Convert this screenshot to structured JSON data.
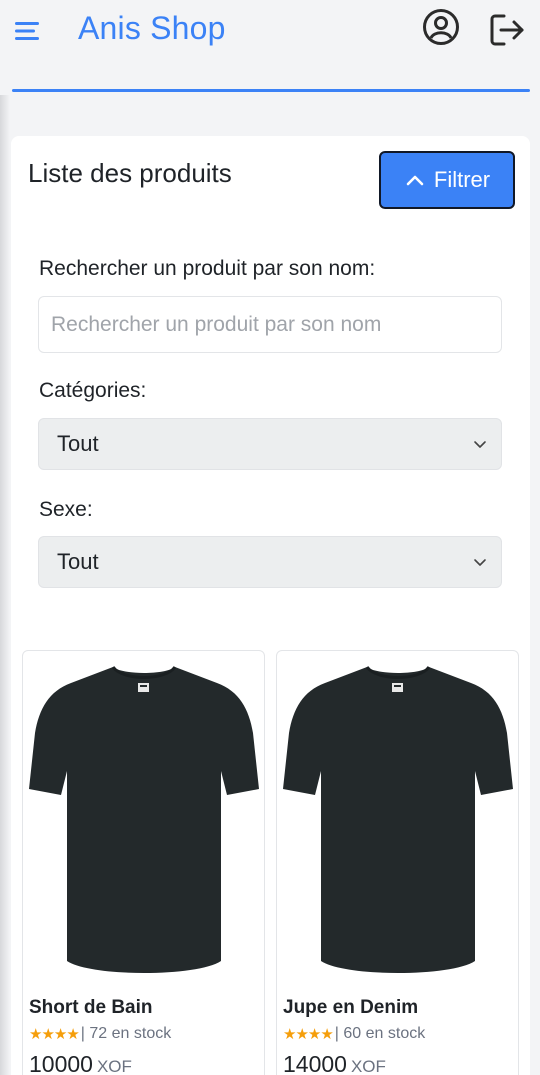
{
  "header": {
    "brand": "Anis Shop",
    "icons": {
      "menu": "menu-icon",
      "user": "user-circle-icon",
      "logout": "logout-icon"
    },
    "accent_color": "#3b82f6"
  },
  "main": {
    "title": "Liste des produits",
    "filter_button": {
      "label": "Filtrer",
      "icon": "chevron-up-icon"
    },
    "search": {
      "label": "Rechercher un produit par son nom:",
      "placeholder": "Rechercher un produit par son nom",
      "value": ""
    },
    "category": {
      "label": "Catégories:",
      "selected": "Tout"
    },
    "gender": {
      "label": "Sexe:",
      "selected": "Tout"
    }
  },
  "products": [
    {
      "name": "Short de Bain",
      "stars": "★★★★",
      "stock": "| 72 en stock",
      "price": "10000",
      "currency": "XOF",
      "image_icon": "tshirt-icon"
    },
    {
      "name": "Jupe en Denim",
      "stars": "★★★★",
      "stock": "| 60 en stock",
      "price": "14000",
      "currency": "XOF",
      "image_icon": "tshirt-icon"
    }
  ]
}
